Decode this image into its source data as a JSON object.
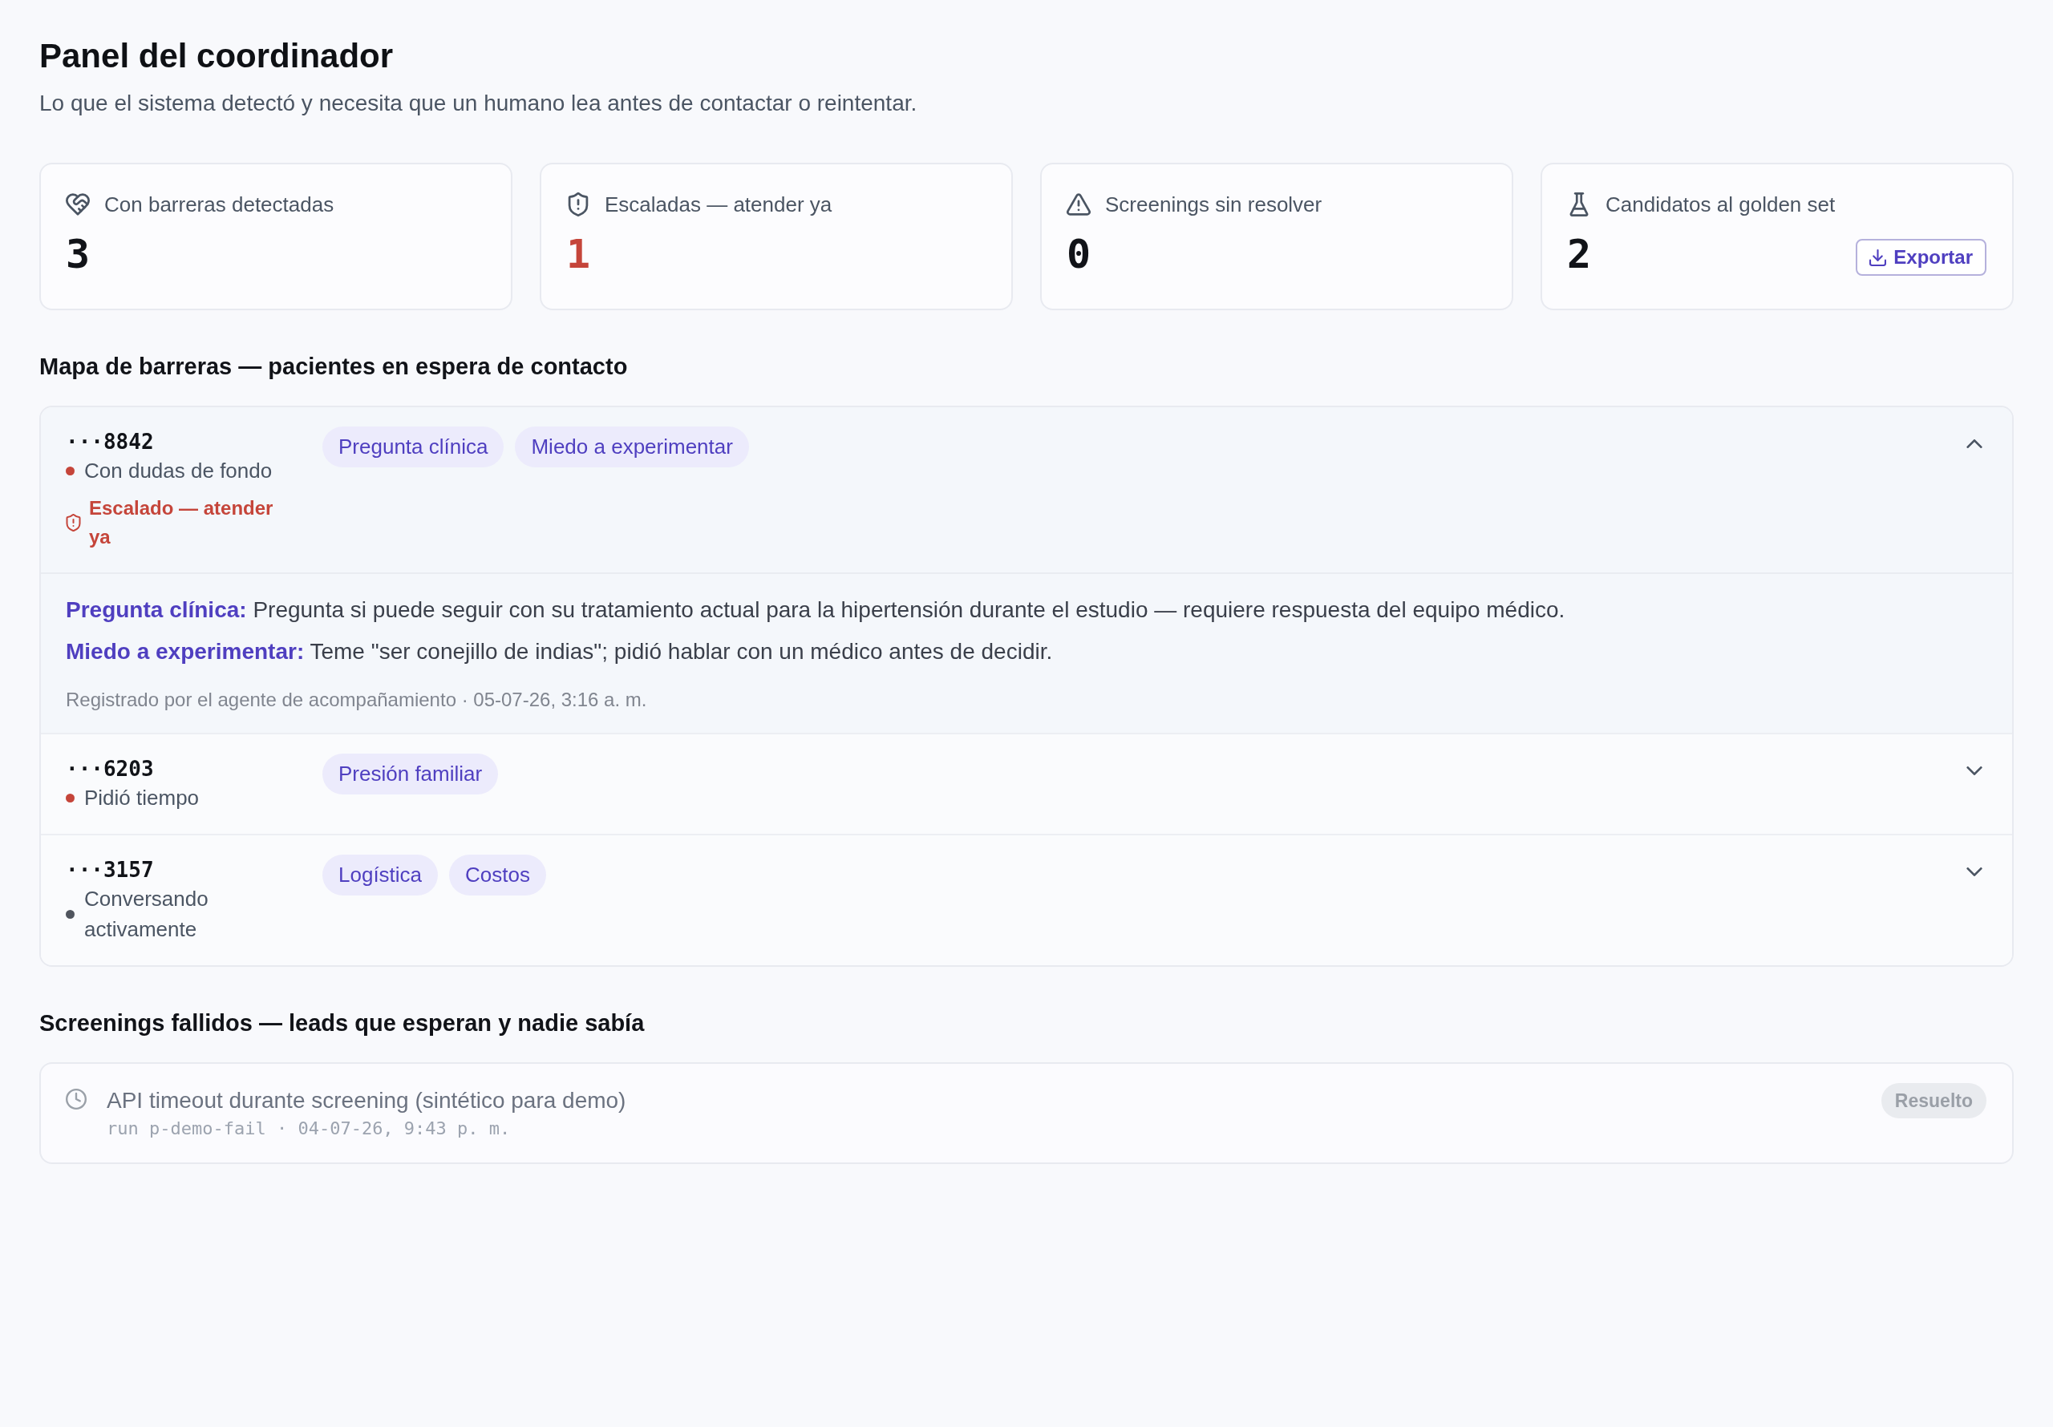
{
  "header": {
    "title": "Panel del coordinador",
    "subtitle": "Lo que el sistema detectó y necesita que un humano lea antes de contactar o reintentar."
  },
  "stats": [
    {
      "label": "Con barreras detectadas",
      "value": "3",
      "alert": false
    },
    {
      "label": "Escaladas — atender ya",
      "value": "1",
      "alert": true
    },
    {
      "label": "Screenings sin resolver",
      "value": "0",
      "alert": false
    },
    {
      "label": "Candidatos al golden set",
      "value": "2",
      "alert": false,
      "action": "Exportar"
    }
  ],
  "barrier_map": {
    "heading": "Mapa de barreras — pacientes en espera de contacto",
    "patients": [
      {
        "id": "···8842",
        "status": "Con dudas de fondo",
        "color": "#c5453a",
        "escalation": "Escalado — atender ya",
        "barriers": [
          "Pregunta clínica",
          "Miedo a experimentar"
        ],
        "expanded": true,
        "details": [
          "**Pregunta clínica:** Pregunta si puede seguir con su tratamiento actual para la hipertensión durante el estudio — requiere respuesta del equipo médico.",
          "**Miedo a experimentar:** Teme \"ser conejillo de indias\"; pidió hablar con un médico antes de decidir."
        ],
        "note": "Registrado por el agente de acompañamiento · 05-07-26, 3:16 a. m."
      },
      {
        "id": "···6203",
        "status": "Pidió tiempo",
        "color": "#c5453a",
        "barriers": [
          "Presión familiar"
        ],
        "expanded": false
      },
      {
        "id": "···3157",
        "status": "Conversando activamente",
        "color": "#50555e",
        "barriers": [
          "Logística",
          "Costos"
        ],
        "expanded": false
      }
    ]
  },
  "failed_screenings": {
    "heading": "Screenings fallidos — leads que esperan y nadie sabía",
    "items": [
      {
        "title": "API timeout durante screening (sintético para demo)",
        "meta": "run p-demo-fail · 04-07-26, 9:43 p. m.",
        "status": "Resuelto",
        "resolved": true
      }
    ]
  }
}
